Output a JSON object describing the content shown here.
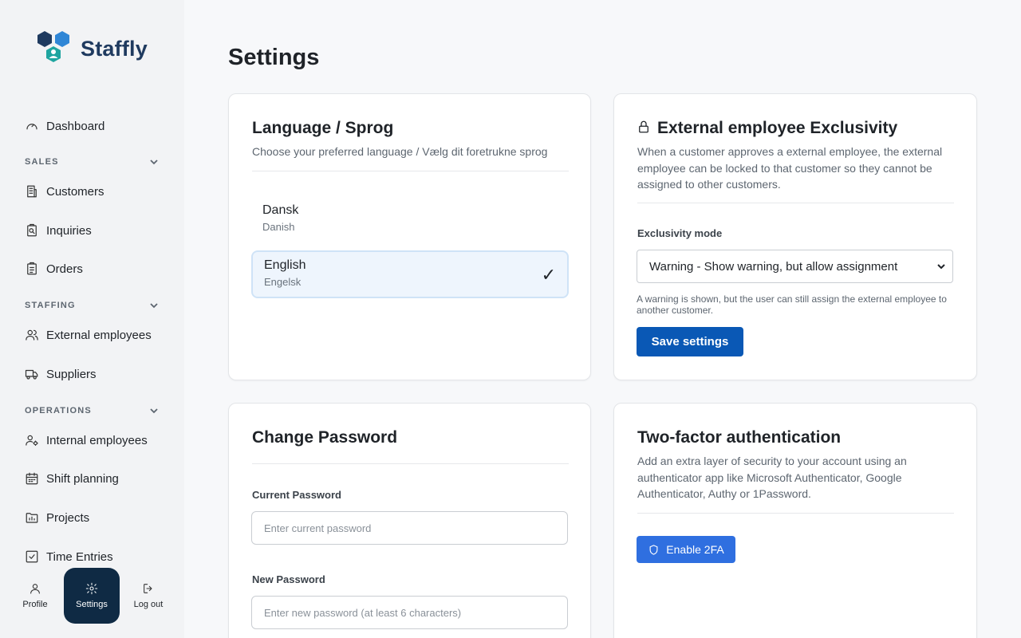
{
  "app": {
    "name": "Staffly",
    "brand_color": "#0f2a44",
    "accent_color": "#0a58b5"
  },
  "sidebar": {
    "dashboard": "Dashboard",
    "sections": [
      {
        "title": "SALES",
        "items": [
          "Customers",
          "Inquiries",
          "Orders"
        ]
      },
      {
        "title": "STAFFING",
        "items": [
          "External employees",
          "Suppliers"
        ]
      },
      {
        "title": "OPERATIONS",
        "items": [
          "Internal employees",
          "Shift planning",
          "Projects",
          "Time Entries"
        ]
      }
    ],
    "bottom": {
      "profile": "Profile",
      "settings": "Settings",
      "logout": "Log out"
    }
  },
  "page": {
    "title": "Settings"
  },
  "language_card": {
    "title": "Language / Sprog",
    "subtitle": "Choose your preferred language / Vælg dit foretrukne sprog",
    "options": [
      {
        "name": "Dansk",
        "sub": "Danish",
        "selected": false
      },
      {
        "name": "English",
        "sub": "Engelsk",
        "selected": true
      }
    ],
    "check": "✓"
  },
  "exclusivity_card": {
    "title": "External employee Exclusivity",
    "description": "When a customer approves a external employee, the external employee can be locked to that customer so they cannot be assigned to other customers.",
    "mode_label": "Exclusivity mode",
    "mode_value": "Warning - Show warning, but allow assignment",
    "hint": "A warning is shown, but the user can still assign the external employee to another customer.",
    "save_label": "Save settings"
  },
  "password_card": {
    "title": "Change Password",
    "current_label": "Current Password",
    "current_placeholder": "Enter current password",
    "new_label": "New Password",
    "new_placeholder": "Enter new password (at least 6 characters)"
  },
  "tfa_card": {
    "title": "Two-factor authentication",
    "description": "Add an extra layer of security to your account using an authenticator app like Microsoft Authenticator, Google Authenticator, Authy or 1Password.",
    "enable_label": "Enable 2FA"
  }
}
